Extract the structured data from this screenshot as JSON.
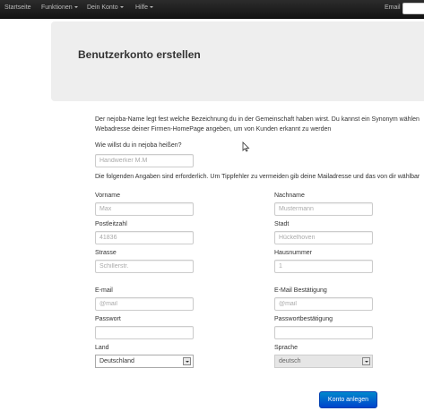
{
  "nav": {
    "items": [
      {
        "label": "Startseite"
      },
      {
        "label": "Funktionen"
      },
      {
        "label": "Dein Konto"
      },
      {
        "label": "Hilfe"
      }
    ],
    "email_label": "Email"
  },
  "hero": {
    "title": "Benutzerkonto erstellen"
  },
  "intro": {
    "line1": "Der nejoba-Name legt fest welche Bezeichnung du in der Gemeinschaft haben wirst. Du kannst ein Synonym wählen",
    "line2": "Webadresse deiner Firmen-HomePage angeben, um von Kunden erkannt zu werden"
  },
  "form": {
    "name_question": "Wie willst du in nejoba heißen?",
    "name_placeholder": "Handwerker M.M",
    "required_note": "Die folgenden Angaben sind erforderlich. Um Tippfehler zu vermeiden gib deine Mailadresse und das von dir wählbar",
    "fields": {
      "vorname": {
        "label": "Vorname",
        "placeholder": "Max"
      },
      "nachname": {
        "label": "Nachname",
        "placeholder": "Mustermann"
      },
      "plz": {
        "label": "Postleitzahl",
        "placeholder": "41836"
      },
      "stadt": {
        "label": "Stadt",
        "placeholder": "Hückelhoven"
      },
      "strasse": {
        "label": "Strasse",
        "placeholder": "Schillerstr."
      },
      "hausnummer": {
        "label": "Hausnummer",
        "placeholder": "1"
      },
      "email": {
        "label": "E-mail",
        "placeholder": "@mail"
      },
      "email_confirm": {
        "label": "E-Mail Bestätigung",
        "placeholder": "@mail"
      },
      "passwort": {
        "label": "Passwort",
        "placeholder": ""
      },
      "passwort_confirm": {
        "label": "Passwortbestätigung",
        "placeholder": ""
      },
      "land": {
        "label": "Land",
        "value": "Deutschland"
      },
      "sprache": {
        "label": "Sprache",
        "value": "deutsch"
      }
    },
    "submit_label": "Konto anlegen"
  }
}
